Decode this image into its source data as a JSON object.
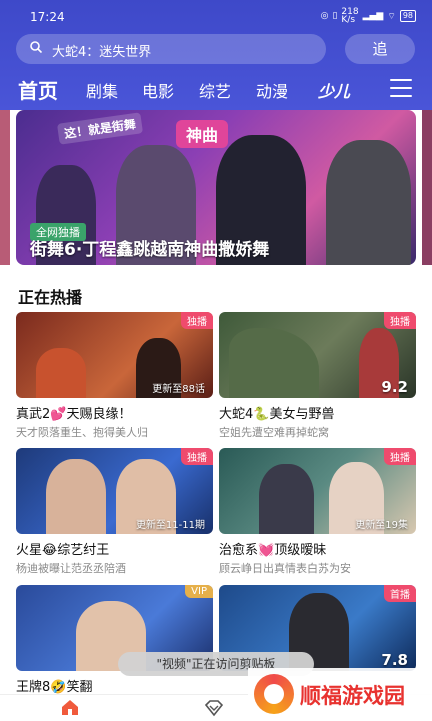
{
  "status": {
    "time": "17:24",
    "net_speed": "218\nK/s",
    "battery": "98"
  },
  "search": {
    "query": "大蛇4：迷失世界"
  },
  "record_button": {
    "label": "追"
  },
  "tabs": [
    {
      "label": "首页"
    },
    {
      "label": "剧集"
    },
    {
      "label": "电影"
    },
    {
      "label": "综艺"
    },
    {
      "label": "动漫"
    },
    {
      "label": "少儿"
    }
  ],
  "banner": {
    "top_tag": "这！就是街舞",
    "stage_sign": "神曲",
    "chip": "全网独播",
    "title": "街舞6·丁程鑫跳越南神曲撒娇舞"
  },
  "section": {
    "title": "正在热播"
  },
  "cards": [
    {
      "title_a": "真武2",
      "title_b": "天赐良缘！",
      "sub": "天才陨落重生、抱得美人归",
      "corner": "独播",
      "corner_color": "#ef4b6d",
      "update": "更新至88话",
      "score": ""
    },
    {
      "title_a": "大蛇4",
      "title_b": "美女与野兽",
      "sub": "空姐先遭空难再掉蛇窝",
      "corner": "独播",
      "corner_color": "#ef4b6d",
      "update": "",
      "score": "9.2"
    },
    {
      "title_a": "火星",
      "title_b": "综艺纣王",
      "sub": "杨迪被曝让范丞丞陪酒",
      "corner": "独播",
      "corner_color": "#ef4b6d",
      "update": "更新至11-11期",
      "score": ""
    },
    {
      "title_a": "治愈系",
      "title_b": "顶级暧昧",
      "sub": "顾云峥日出真情表白苏为安",
      "corner": "独播",
      "corner_color": "#ef4b6d",
      "update": "更新至19集",
      "score": ""
    },
    {
      "title_a": "王牌8",
      "title_b": "笑翻",
      "sub": "",
      "corner": "VIP",
      "corner_color": "#e6b04a",
      "update": "",
      "score": ""
    },
    {
      "title_a": "",
      "title_b": "",
      "sub": "",
      "corner": "首播",
      "corner_color": "#ef4b6d",
      "update": "",
      "score": "7.8"
    }
  ],
  "toast": {
    "text": "\"视频\"正在访问剪贴板"
  },
  "watermark": {
    "text": "顺福游戏园"
  },
  "colors": {
    "header": "#4550d6",
    "accent_pink": "#ef4b6d",
    "vip_gold": "#e6b04a"
  }
}
